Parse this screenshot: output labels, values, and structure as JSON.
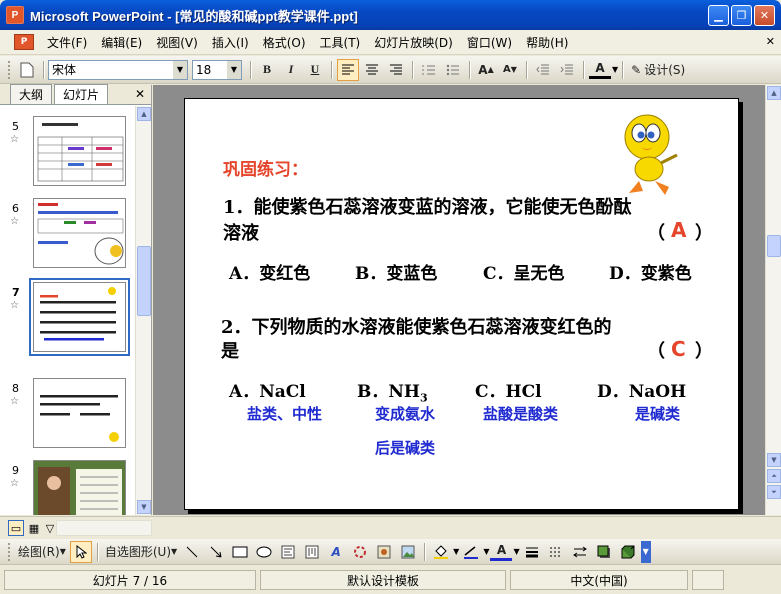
{
  "window": {
    "title": "Microsoft PowerPoint - [常见的酸和碱ppt教学课件.ppt]",
    "app_icon_label": "P",
    "minimize": "▁",
    "restore": "❐",
    "close": "✕"
  },
  "menu": {
    "logo": "P",
    "items": [
      "文件(F)",
      "编辑(E)",
      "视图(V)",
      "插入(I)",
      "格式(O)",
      "工具(T)",
      "幻灯片放映(D)",
      "窗口(W)",
      "帮助(H)"
    ],
    "close": "✕"
  },
  "toolbar": {
    "font_name": "宋体",
    "font_size": "18",
    "bold": "B",
    "italic": "I",
    "underline": "U",
    "font_color_label": "A",
    "design_label": "设计(S)"
  },
  "left_pane": {
    "tabs": [
      "大纲",
      "幻灯片"
    ],
    "active_tab": "幻灯片",
    "close": "✕",
    "thumbnails": [
      {
        "num": "5",
        "star": "☆"
      },
      {
        "num": "6",
        "star": "☆"
      },
      {
        "num": "7",
        "star": "☆"
      },
      {
        "num": "8",
        "star": "☆"
      },
      {
        "num": "9",
        "star": "☆"
      }
    ],
    "selected": "7"
  },
  "slide": {
    "heading": "巩固练习：",
    "q1_line1": "1．能使紫色石蕊溶液变蓝的溶液，它能使无色酚酞",
    "q1_line2": "溶液",
    "q1_paren_open": "（",
    "q1_answer": "A",
    "q1_paren_close": "）",
    "q1_options": [
      "A．变红色",
      "B．变蓝色",
      "C．呈无色",
      "D．变紫色"
    ],
    "q2_line1": "2．下列物质的水溶液能使紫色石蕊溶液变红色的",
    "q2_line2": "是",
    "q2_paren_open": "（",
    "q2_answer": "C",
    "q2_paren_close": "）",
    "q2_options": [
      "A．NaCl",
      "B．NH",
      "C．HCl",
      "D．NaOH"
    ],
    "q2_option_b_sub": "3",
    "notes": [
      "盐类、中性",
      "变成氨水",
      "盐酸是酸类",
      "是碱类"
    ],
    "note_b_line2": "后是碱类"
  },
  "drawbar": {
    "draw_label": "绘图(R)",
    "autoshape_label": "自选图形(U)",
    "font_color_label": "A"
  },
  "status": {
    "slide_info": "幻灯片 7 / 16",
    "template": "默认设计模板",
    "language": "中文(中国)"
  },
  "colors": {
    "heading": "#e5452b",
    "answer": "#e5452b",
    "note": "#1f2ad0",
    "titlebar": "#0542b8"
  }
}
